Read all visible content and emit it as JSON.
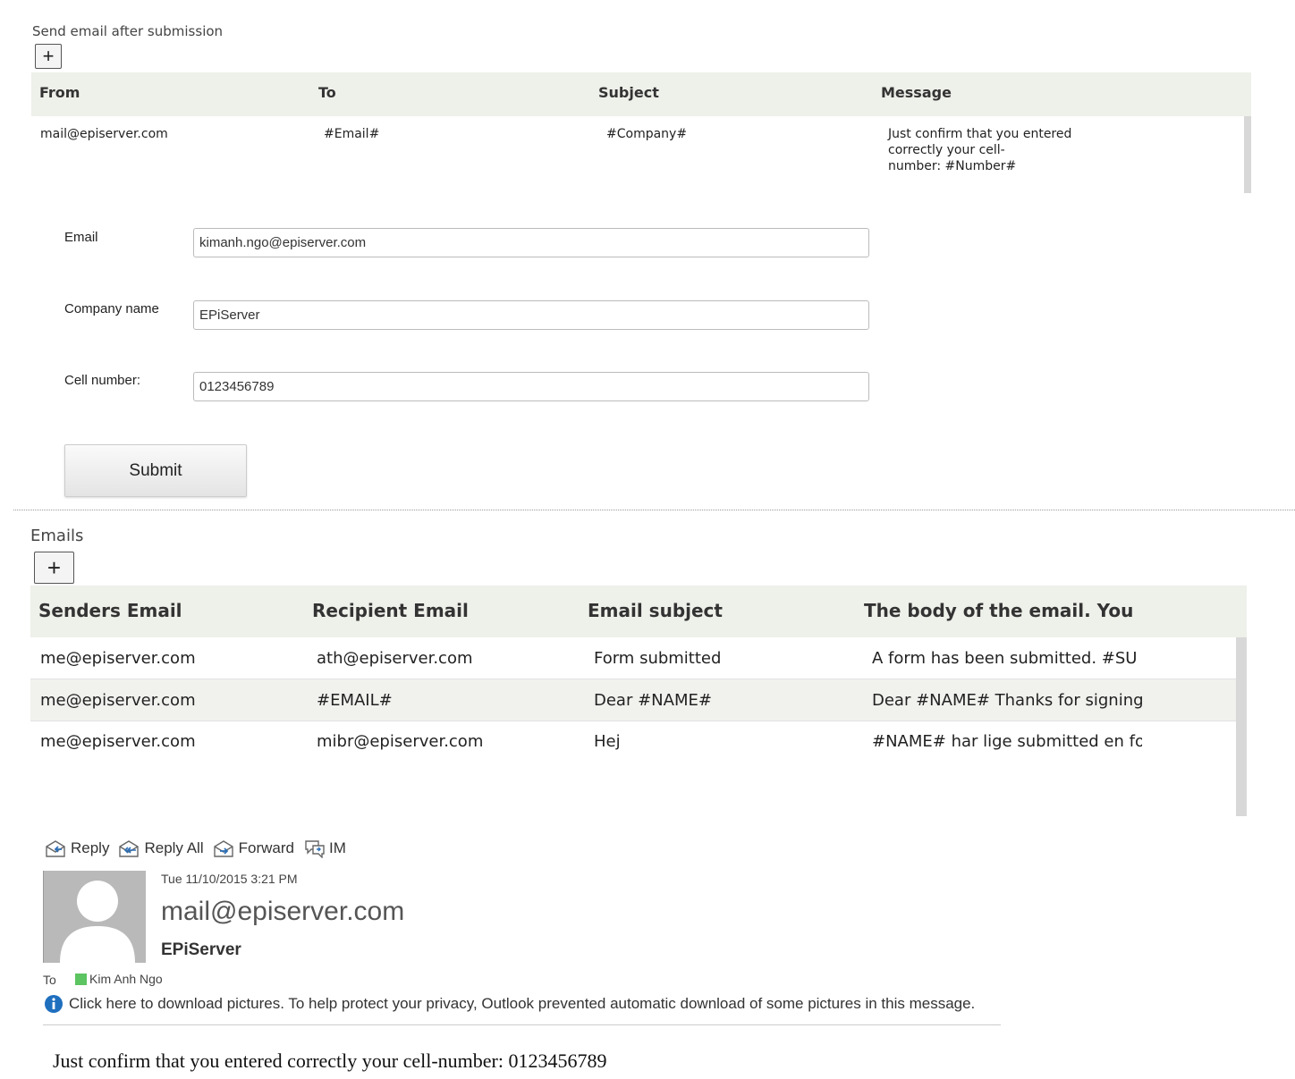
{
  "send_section": {
    "label": "Send email after submission",
    "add_label": "+",
    "columns": [
      "From",
      "To",
      "Subject",
      "Message"
    ],
    "row": {
      "from": "mail@episerver.com",
      "to": "#Email#",
      "subject": "#Company#",
      "message_lines": [
        "Just confirm that you entered",
        "correctly your cell-",
        "number: #Number#"
      ]
    }
  },
  "form": {
    "email_label": "Email",
    "email_value": "kimanh.ngo@episerver.com",
    "company_label": "Company name",
    "company_value": "EPiServer",
    "cell_label": "Cell number:",
    "cell_value": "0123456789",
    "submit_label": "Submit"
  },
  "emails_section": {
    "label": "Emails",
    "add_label": "+",
    "columns": [
      "Senders Email",
      "Recipient Email",
      "Email subject",
      "The body of the email. You"
    ],
    "rows": [
      {
        "sender": "me@episerver.com",
        "recipient": "ath@episerver.com",
        "subject": "Form submitted",
        "body": "A form has been submitted. #SU"
      },
      {
        "sender": "me@episerver.com",
        "recipient": "#EMAIL#",
        "subject": "Dear #NAME#",
        "body": "Dear #NAME# Thanks for signing"
      },
      {
        "sender": "me@episerver.com",
        "recipient": "mibr@episerver.com",
        "subject": "Hej",
        "body": "#NAME# har lige submitted en fo"
      }
    ]
  },
  "email_preview": {
    "toolbar": [
      {
        "label": "Reply",
        "icon": "reply-icon"
      },
      {
        "label": "Reply All",
        "icon": "reply-all-icon"
      },
      {
        "label": "Forward",
        "icon": "forward-icon"
      },
      {
        "label": "IM",
        "icon": "im-icon"
      }
    ],
    "datetime": "Tue 11/10/2015 3:21 PM",
    "sender": "mail@episerver.com",
    "company": "EPiServer",
    "to_label": "To",
    "to_name": "Kim Anh Ngo",
    "info_text": "Click here to download pictures. To help protect your privacy, Outlook prevented automatic download of some pictures in this message.",
    "body": "Just confirm that you entered correctly your cell-number: 0123456789",
    "colors": {
      "presence": "#5cc461",
      "info": "#1f6fbf",
      "header_bg": "#eef0ea"
    }
  }
}
